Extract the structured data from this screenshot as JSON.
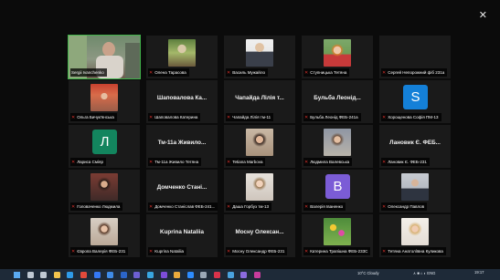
{
  "window": {
    "close_glyph": "✕"
  },
  "participants": [
    {
      "display_name": "Sergii Ivanchenko",
      "type": "video",
      "active": true
    },
    {
      "display_name": "Олена Тарасова",
      "type": "photo",
      "photo": "trees"
    },
    {
      "display_name": "Василь Мужайло",
      "type": "photo",
      "photo": "suit"
    },
    {
      "display_name": "Ступницька Тетяна",
      "type": "photo",
      "photo": "woman-red"
    },
    {
      "display_name": "Сергей Непорожний фіб 231а",
      "type": "none"
    },
    {
      "display_name": "Ольга Бичук'янська",
      "type": "photo",
      "photo": "woman-hat"
    },
    {
      "display_name": "Шаповалова Катерина",
      "type": "name",
      "big_name": "Шаповалова Ка..."
    },
    {
      "display_name": "Чапайда Лілія тм-11",
      "type": "name",
      "big_name": "Чапайда Лілія т..."
    },
    {
      "display_name": "Бульба Леонід ФЕБ-241а",
      "type": "name",
      "big_name": "Бульба Леонід..."
    },
    {
      "display_name": "Хорощенова Софія ПМ-13",
      "type": "letter",
      "letter": "S",
      "color": "#1480d8"
    },
    {
      "display_name": "Лариса Сміяр",
      "type": "letter",
      "letter": "Л",
      "color": "#13855e"
    },
    {
      "display_name": "Тм-11а Живило Тетяна",
      "type": "name",
      "big_name": "Тм-11а Живило..."
    },
    {
      "display_name": "Tetiana Marbova",
      "type": "photo",
      "photo": "woman-dark"
    },
    {
      "display_name": "Людмила Валевська",
      "type": "photo",
      "photo": "woman-blonde"
    },
    {
      "display_name": "Лановик Є. ФЕБ-231",
      "type": "name",
      "big_name": "Лановик Є. ФЕБ..."
    },
    {
      "display_name": "Головаченко Людмила",
      "type": "photo",
      "photo": "woman-dark2"
    },
    {
      "display_name": "Домченко Станіслав ФЕБ-241...",
      "type": "name",
      "big_name": "Домченко Стані..."
    },
    {
      "display_name": "Даша Горбуз тм-13",
      "type": "photo",
      "photo": "woman-light"
    },
    {
      "display_name": "Валерія Іваненко",
      "type": "letter",
      "letter": "B",
      "color": "#7b5cd6"
    },
    {
      "display_name": "Олександр Павлов",
      "type": "photo",
      "photo": "man"
    },
    {
      "display_name": "Європа Валерія ФЕБ-231",
      "type": "photo",
      "photo": "woman-brown"
    },
    {
      "display_name": "Kuprina Nataliia",
      "type": "name",
      "big_name": "Kuprina Nataliia"
    },
    {
      "display_name": "Мосну Олександр ФЕБ-231",
      "type": "name",
      "big_name": "Мосну Олексан..."
    },
    {
      "display_name": "Катерина Трапішна ФЕБ-233С",
      "type": "photo",
      "photo": "flowers"
    },
    {
      "display_name": "Тетяна Анатоліївна Куликова",
      "type": "photo",
      "photo": "woman-blonde2"
    }
  ],
  "taskbar": {
    "icons": [
      "windows-start-icon",
      "search-icon",
      "task-view-icon",
      "file-explorer-icon",
      "edge-icon",
      "chrome-icon",
      "store-icon",
      "mail-icon",
      "word-icon",
      "teams-icon",
      "telegram-icon",
      "viber-icon",
      "photos-icon",
      "zoom-icon",
      "settings-icon",
      "app-icon",
      "app-icon-2",
      "app-icon-3",
      "app-icon-4"
    ],
    "icon_colors": [
      "#5aa9f0",
      "#bfc8d2",
      "#bfc8d2",
      "#f3c44d",
      "#2f9be8",
      "#e24a3b",
      "#3478f6",
      "#3f8ce8",
      "#2b65c9",
      "#6b5fd3",
      "#39a6e2",
      "#7c4dd8",
      "#e9a93c",
      "#2d8cff",
      "#9aa7b5",
      "#d8324a",
      "#4aa3df",
      "#8b6be0",
      "#c83c9c"
    ],
    "weather": "10°C Cloudy",
    "tray": "∧ ■ ⌂ ◐ ENG",
    "time": "19:17"
  }
}
